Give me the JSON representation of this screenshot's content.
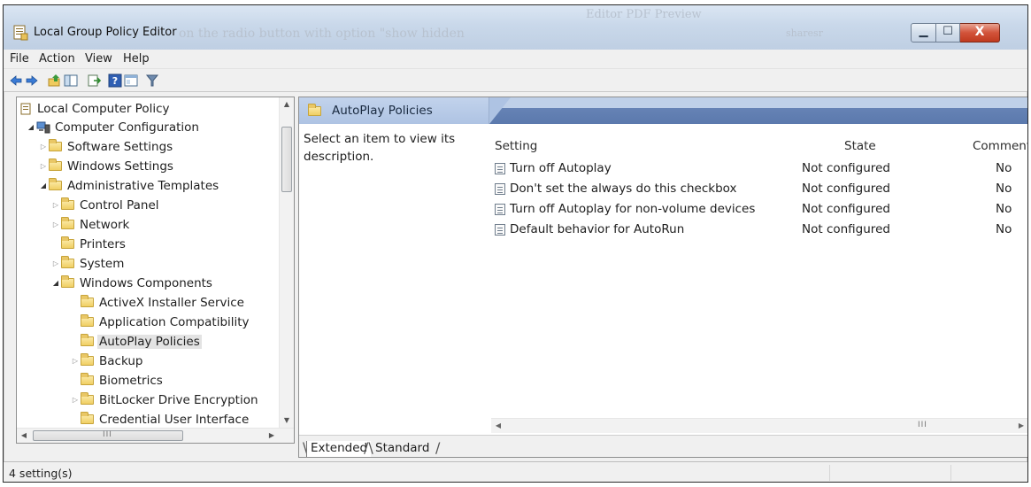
{
  "window": {
    "title": "Local Group Policy Editor",
    "ghost_texts": [
      "on the radio button with option \"show hidden",
      "Editor    PDF Preview",
      "sharesr"
    ],
    "controls": {
      "minimize": "▁",
      "maximize": "☐",
      "close": "X"
    }
  },
  "menu": {
    "items": [
      "File",
      "Action",
      "View",
      "Help"
    ]
  },
  "toolbar": {
    "icons": [
      "back-arrow-icon",
      "forward-arrow-icon",
      "up-folder-icon",
      "show-hide-tree-icon",
      "export-list-icon",
      "help-icon",
      "properties-icon",
      "filter-icon"
    ]
  },
  "tree": {
    "items": [
      {
        "label": "Local Computer Policy",
        "expander": ""
      },
      {
        "label": "Computer Configuration",
        "expander": "◢"
      },
      {
        "label": "Software Settings",
        "expander": "▷"
      },
      {
        "label": "Windows Settings",
        "expander": "▷"
      },
      {
        "label": "Administrative Templates",
        "expander": "◢"
      },
      {
        "label": "Control Panel",
        "expander": "▷"
      },
      {
        "label": "Network",
        "expander": "▷"
      },
      {
        "label": "Printers",
        "expander": ""
      },
      {
        "label": "System",
        "expander": "▷"
      },
      {
        "label": "Windows Components",
        "expander": "◢"
      },
      {
        "label": "ActiveX Installer Service",
        "expander": ""
      },
      {
        "label": "Application Compatibility",
        "expander": ""
      },
      {
        "label": "AutoPlay Policies",
        "expander": ""
      },
      {
        "label": "Backup",
        "expander": "▷"
      },
      {
        "label": "Biometrics",
        "expander": ""
      },
      {
        "label": "BitLocker Drive Encryption",
        "expander": "▷"
      },
      {
        "label": "Credential User Interface",
        "expander": ""
      }
    ],
    "scroll_grip": "III"
  },
  "details": {
    "header_title": "AutoPlay Policies",
    "description": "Select an item to view its description.",
    "columns": {
      "setting": "Setting",
      "state": "State",
      "comment": "Comment"
    },
    "rows": [
      {
        "setting": "Turn off Autoplay",
        "state": "Not configured",
        "comment": "No"
      },
      {
        "setting": "Don't set the always do this checkbox",
        "state": "Not configured",
        "comment": "No"
      },
      {
        "setting": "Turn off Autoplay for non-volume devices",
        "state": "Not configured",
        "comment": "No"
      },
      {
        "setting": "Default behavior for AutoRun",
        "state": "Not configured",
        "comment": "No"
      }
    ],
    "scroll_grip": "III",
    "view_tabs": {
      "extended": "Extended",
      "standard": "Standard"
    }
  },
  "status": {
    "text": "4 setting(s)"
  }
}
